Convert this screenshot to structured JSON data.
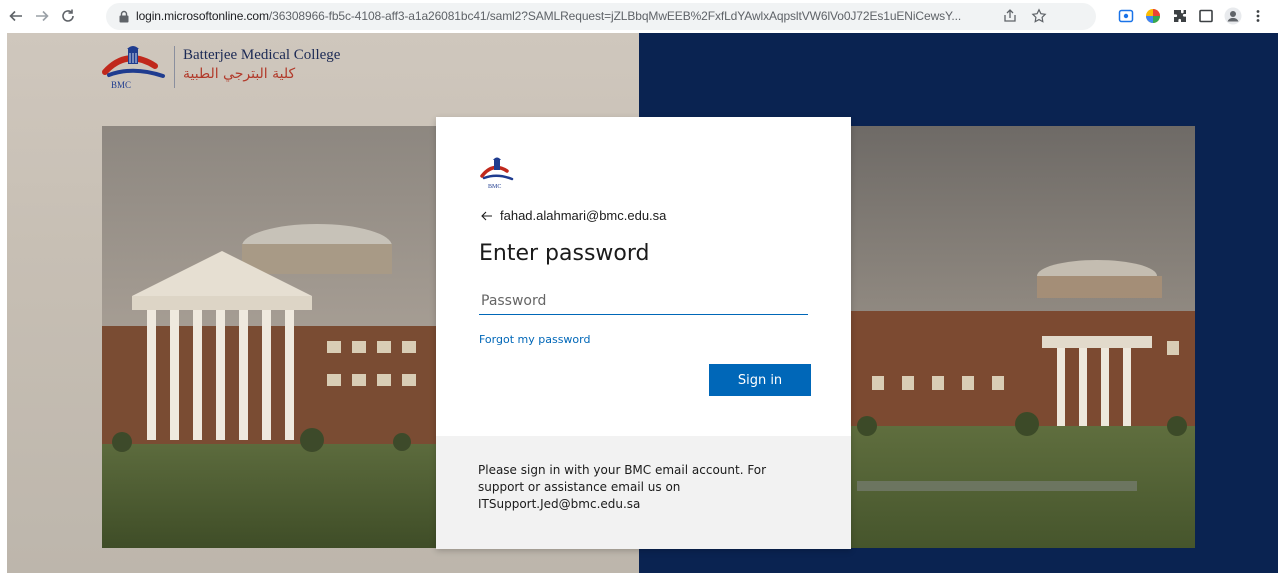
{
  "browser": {
    "url_host": "login.microsoftonline.com",
    "url_path": "/36308966-fb5c-4108-aff3-a1a26081bc41/saml2?SAMLRequest=jZLBbqMwEEB%2FxfLdYAwlxAqpsltVW6lVo0J72Es1uENiCewsY...",
    "colors": {
      "accent": "#0067b8",
      "chrome_bg": "#f1f3f4"
    }
  },
  "brand": {
    "logo_mark": "BMC",
    "name_en": "Batterjee Medical College",
    "name_ar": "كلية البترجي الطبية"
  },
  "card": {
    "logo_mark": "BMC",
    "account_email": "fahad.alahmari@bmc.edu.sa",
    "title": "Enter password",
    "password_placeholder": "Password",
    "forgot_link": "Forgot my password",
    "signin_label": "Sign in",
    "footer_text": "Please sign in with your BMC email account. For support or assistance email us on ITSupport.Jed@bmc.edu.sa"
  },
  "page": {
    "colors": {
      "right_background": "#0a2351",
      "primary_button": "#0067b8"
    }
  }
}
